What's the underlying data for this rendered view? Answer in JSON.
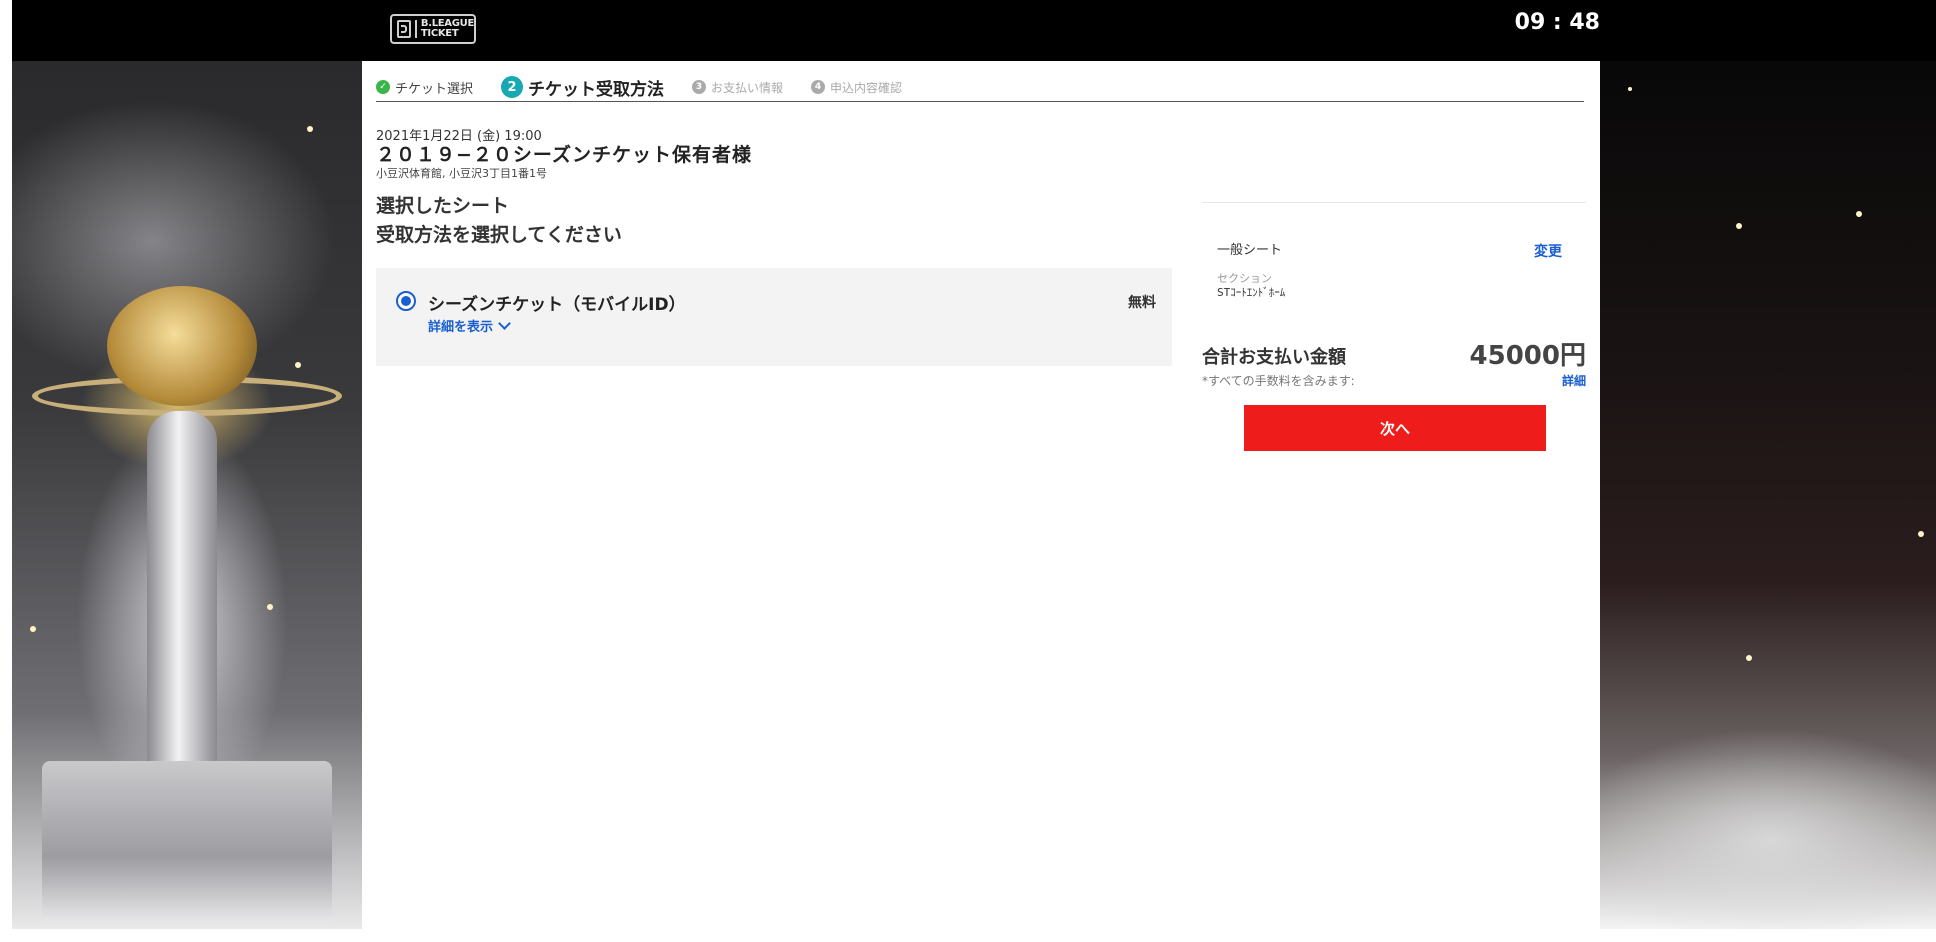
{
  "header": {
    "logo_text_line1": "B.LEAGUE",
    "logo_text_line2": "TICKET",
    "clock": "09 : 48"
  },
  "steps": [
    {
      "label": "チケット選択",
      "state": "done",
      "number": "✓"
    },
    {
      "label": "チケット受取方法",
      "state": "active",
      "number": "2"
    },
    {
      "label": "お支払い情報",
      "state": "future",
      "number": "3"
    },
    {
      "label": "申込内容確認",
      "state": "future",
      "number": "4"
    }
  ],
  "event": {
    "date": "2021年1月22日 (金) 19:00",
    "title": "２０１９−２０シーズンチケット保有者様",
    "venue": "小豆沢体育館, 小豆沢3丁目1番1号"
  },
  "main": {
    "selected_seat_heading": "選択したシート",
    "select_method_heading": "受取方法を選択してください",
    "option": {
      "label": "シーズンチケット（モバイルID）",
      "detail_link": "詳細を表示",
      "price": "無料",
      "selected": true
    }
  },
  "summary": {
    "seat_type": "一般シート",
    "change_link": "変更",
    "section_label": "セクション",
    "section_value": "STｺｰﾄｴﾝﾄﾞﾎｰﾑ",
    "total_label": "合計お支払い金額",
    "total_value": "45000円",
    "fee_note": "*すべての手数料を含みます:",
    "fee_detail": "詳細",
    "next_button": "次へ"
  },
  "colors": {
    "accent_blue": "#1a5fd0",
    "next_red": "#ef1c1c",
    "step_active": "#18a8b2",
    "step_done": "#3bb54a"
  }
}
